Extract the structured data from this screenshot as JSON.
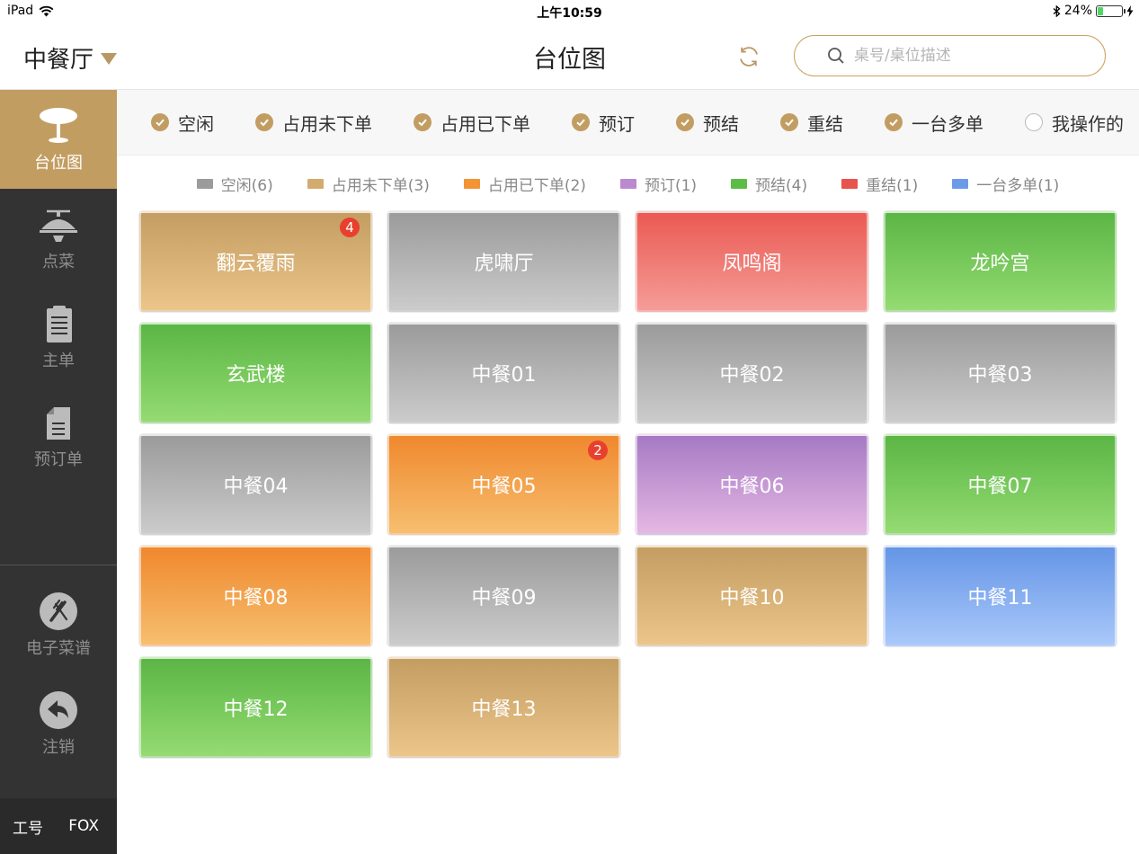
{
  "status_bar": {
    "device": "iPad",
    "time": "上午10:59",
    "battery_text": "24%",
    "battery_level": 0.24
  },
  "header": {
    "hall_name": "中餐厅",
    "title": "台位图",
    "search_placeholder": "桌号/桌位描述"
  },
  "sidebar": {
    "items": [
      {
        "label": "台位图",
        "icon": "table-icon",
        "active": true
      },
      {
        "label": "点菜",
        "icon": "dish-cover-icon",
        "active": false
      },
      {
        "label": "主单",
        "icon": "clipboard-icon",
        "active": false
      },
      {
        "label": "预订单",
        "icon": "document-icon",
        "active": false
      },
      {
        "label": "电子菜谱",
        "icon": "menu-cutlery-icon",
        "active": false
      },
      {
        "label": "注销",
        "icon": "logout-arrow-icon",
        "active": false
      }
    ],
    "footer": {
      "label": "工号",
      "user": "FOX"
    }
  },
  "filters": [
    {
      "label": "空闲",
      "checked": true
    },
    {
      "label": "占用未下单",
      "checked": true
    },
    {
      "label": "占用已下单",
      "checked": true
    },
    {
      "label": "预订",
      "checked": true
    },
    {
      "label": "预结",
      "checked": true
    },
    {
      "label": "重结",
      "checked": true
    },
    {
      "label": "一台多单",
      "checked": true
    },
    {
      "label": "我操作的",
      "checked": false
    }
  ],
  "legend": [
    {
      "label": "空闲(6)",
      "color": "#9b9b9b"
    },
    {
      "label": "占用未下单(3)",
      "color": "#d4ab6e"
    },
    {
      "label": "占用已下单(2)",
      "color": "#f29433"
    },
    {
      "label": "预订(1)",
      "color": "#b98ad0"
    },
    {
      "label": "预结(4)",
      "color": "#5cbd46"
    },
    {
      "label": "重结(1)",
      "color": "#e8534d"
    },
    {
      "label": "一台多单(1)",
      "color": "#6b9be8"
    }
  ],
  "tables": [
    {
      "name": "翻云覆雨",
      "status": "occ-none",
      "badge": "4"
    },
    {
      "name": "虎啸厅",
      "status": "idle",
      "badge": ""
    },
    {
      "name": "凤鸣阁",
      "status": "rebill",
      "badge": ""
    },
    {
      "name": "龙吟宫",
      "status": "prebill",
      "badge": ""
    },
    {
      "name": "玄武楼",
      "status": "prebill",
      "badge": ""
    },
    {
      "name": "中餐01",
      "status": "idle",
      "badge": ""
    },
    {
      "name": "中餐02",
      "status": "idle",
      "badge": ""
    },
    {
      "name": "中餐03",
      "status": "idle",
      "badge": ""
    },
    {
      "name": "中餐04",
      "status": "idle",
      "badge": ""
    },
    {
      "name": "中餐05",
      "status": "occ-ord",
      "badge": "2"
    },
    {
      "name": "中餐06",
      "status": "reserve",
      "badge": ""
    },
    {
      "name": "中餐07",
      "status": "prebill",
      "badge": ""
    },
    {
      "name": "中餐08",
      "status": "occ-ord",
      "badge": ""
    },
    {
      "name": "中餐09",
      "status": "idle",
      "badge": ""
    },
    {
      "name": "中餐10",
      "status": "occ-none",
      "badge": ""
    },
    {
      "name": "中餐11",
      "status": "multi",
      "badge": ""
    },
    {
      "name": "中餐12",
      "status": "prebill",
      "badge": ""
    },
    {
      "name": "中餐13",
      "status": "occ-none",
      "badge": ""
    }
  ]
}
